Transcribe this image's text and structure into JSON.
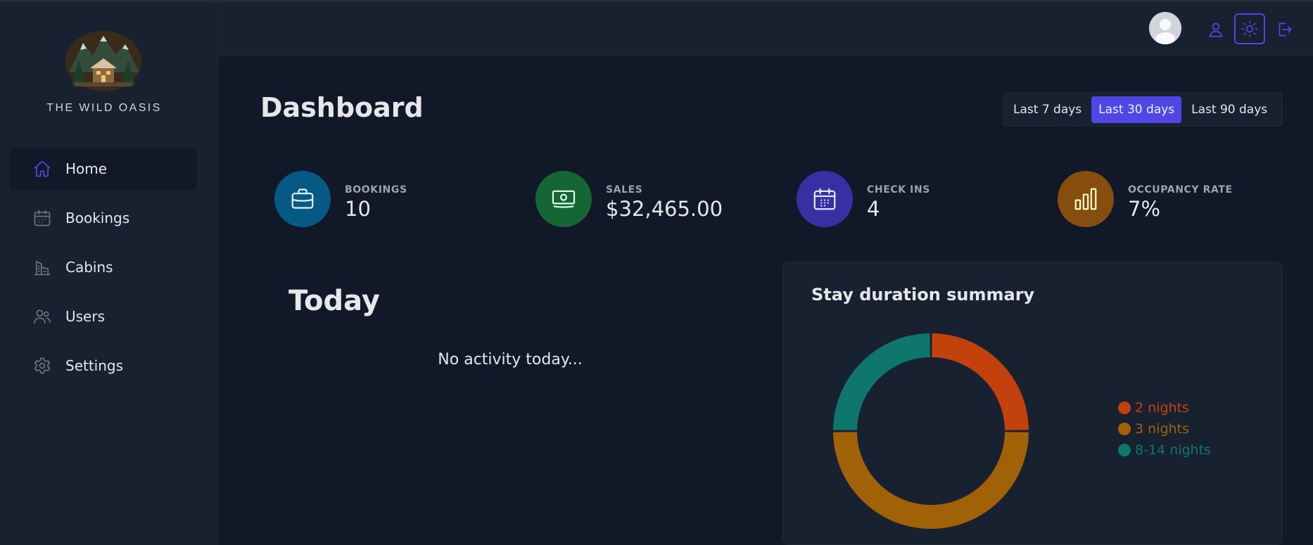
{
  "brand": {
    "name": "THE WILD OASIS"
  },
  "sidebar": {
    "items": [
      {
        "label": "Home",
        "icon": "home-icon",
        "active": true
      },
      {
        "label": "Bookings",
        "icon": "calendar-icon",
        "active": false
      },
      {
        "label": "Cabins",
        "icon": "building-icon",
        "active": false
      },
      {
        "label": "Users",
        "icon": "users-icon",
        "active": false
      },
      {
        "label": "Settings",
        "icon": "gear-icon",
        "active": false
      }
    ]
  },
  "header": {
    "buttons": [
      "user-icon",
      "sun-icon",
      "logout-icon"
    ]
  },
  "main": {
    "title": "Dashboard",
    "filters": [
      {
        "label": "Last 7 days",
        "active": false
      },
      {
        "label": "Last 30 days",
        "active": true
      },
      {
        "label": "Last 90 days",
        "active": false
      }
    ],
    "stats": [
      {
        "label": "BOOKINGS",
        "value": "10",
        "color": "#075985",
        "icon": "briefcase-icon"
      },
      {
        "label": "SALES",
        "value": "$32,465.00",
        "color": "#166534",
        "icon": "banknotes-icon"
      },
      {
        "label": "CHECK INS",
        "value": "4",
        "color": "#3730a3",
        "icon": "calendar-days-icon"
      },
      {
        "label": "OCCUPANCY RATE",
        "value": "7%",
        "color": "#854d0e",
        "icon": "chart-bar-icon"
      }
    ],
    "today": {
      "title": "Today",
      "empty_text": "No activity today..."
    },
    "duration": {
      "title": "Stay duration summary"
    }
  },
  "chart_data": {
    "type": "pie",
    "title": "Stay duration summary",
    "categories": [
      "2 nights",
      "3 nights",
      "8-14 nights"
    ],
    "values": [
      1,
      2,
      1
    ],
    "colors": [
      "#c2410c",
      "#a16207",
      "#0f766e"
    ],
    "legend_position": "right"
  },
  "colors": {
    "accent": "#4f46e5",
    "background": "#111827",
    "panel": "#18212f"
  }
}
